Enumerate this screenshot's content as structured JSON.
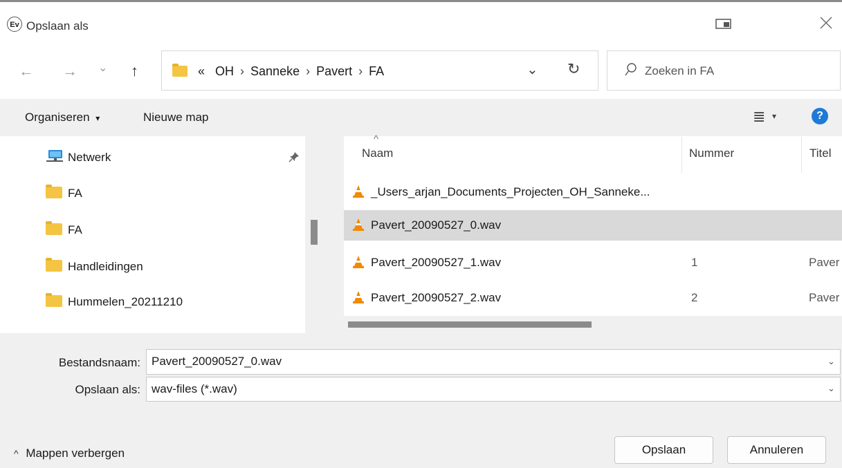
{
  "window": {
    "title": "Opslaan als",
    "app_icon_text": "Ev"
  },
  "nav": {
    "back": "←",
    "forward": "→",
    "recent": "⌄",
    "up": "↑",
    "breadcrumb_overflow": "«",
    "breadcrumbs": [
      "OH",
      "Sanneke",
      "Pavert",
      "FA"
    ],
    "separator": "›",
    "dropdown": "⌄",
    "refresh": "↻"
  },
  "search": {
    "placeholder": "Zoeken in FA",
    "icon": "search-icon"
  },
  "toolbar": {
    "organize_label": "Organiseren",
    "organize_arrow": "▾",
    "new_folder_label": "Nieuwe map",
    "view_icon": "≣",
    "view_arrow": "▾",
    "help_label": "?"
  },
  "sidebar": {
    "items": [
      {
        "label": "Netwerk",
        "icon": "network-icon",
        "pinned": true
      },
      {
        "label": "FA",
        "icon": "folder-icon"
      },
      {
        "label": "FA",
        "icon": "folder-icon"
      },
      {
        "label": "Handleidingen",
        "icon": "folder-icon"
      },
      {
        "label": "Hummelen_20211210",
        "icon": "folder-icon"
      }
    ]
  },
  "filelist": {
    "sort_arrow": "^",
    "columns": [
      "Naam",
      "Nummer",
      "Titel"
    ],
    "rows": [
      {
        "name": "_Users_arjan_Documents_Projecten_OH_Sanneke...",
        "number": "",
        "title": "",
        "selected": false
      },
      {
        "name": "Pavert_20090527_0.wav",
        "number": "",
        "title": "",
        "selected": true
      },
      {
        "name": "Pavert_20090527_1.wav",
        "number": "1",
        "title": "Paver",
        "selected": false
      },
      {
        "name": "Pavert_20090527_2.wav",
        "number": "2",
        "title": "Paver",
        "selected": false
      }
    ]
  },
  "form": {
    "filename_label": "Bestandsnaam:",
    "filename_value": "Pavert_20090527_0.wav",
    "type_label": "Opslaan als:",
    "type_value": "wav-files (*.wav)",
    "dropdown_chevron": "⌄"
  },
  "footer": {
    "hide_folders_icon": "^",
    "hide_folders_label": "Mappen verbergen",
    "save_label": "Opslaan",
    "cancel_label": "Annuleren"
  },
  "colors": {
    "toolbar_bg": "#f0f0f0",
    "selected_row": "#d9d9d9",
    "help_blue": "#1e7ad7",
    "folder_yellow": "#f4c542",
    "vlc_orange": "#f08a00"
  }
}
